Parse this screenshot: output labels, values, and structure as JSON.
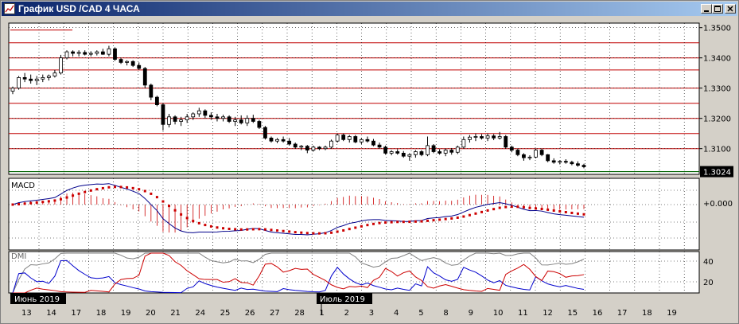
{
  "window": {
    "title": "График USD /CAD  4 ЧАСА",
    "buttons": [
      "minimize",
      "maximize",
      "close"
    ]
  },
  "colors": {
    "bg": "#d4d0c8",
    "plot_bg": "#ffffff",
    "level_line": "#c00000",
    "grid": "#000000",
    "macd_line": "#00008b",
    "signal_dots": "#cc0000",
    "dmi_plus": "#0000cc",
    "dmi_minus": "#cc0000",
    "adx": "#808080",
    "current_price_line": "#006400"
  },
  "main_panel": {
    "price_labels": [
      "1.3500",
      "1.3400",
      "1.3300",
      "1.3200",
      "1.3100"
    ],
    "current_price": "1.3024",
    "ylim": [
      1.3015,
      1.3515
    ]
  },
  "macd_panel": {
    "name": "MACD",
    "zero_label": "+0.000"
  },
  "dmi_panel": {
    "name": "DMI",
    "labels": [
      "40",
      "20"
    ]
  },
  "x_axis": {
    "month_labels": [
      "Июнь 2019",
      "Июль 2019"
    ],
    "day_labels": [
      "13",
      "14",
      "17",
      "18",
      "19",
      "20",
      "21",
      "24",
      "25",
      "26",
      "27",
      "28",
      "1",
      "2",
      "3",
      "4",
      "5",
      "8",
      "9",
      "10",
      "11",
      "12",
      "15",
      "16",
      "17",
      "18",
      "19"
    ]
  },
  "chart_data": {
    "type": "candlestick",
    "title": "График USD /CAD  4 ЧАСА",
    "series": [
      {
        "name": "USD/CAD",
        "values": [
          [
            1.329,
            1.3305,
            1.328,
            1.33
          ],
          [
            1.33,
            1.334,
            1.3295,
            1.3335
          ],
          [
            1.3335,
            1.335,
            1.332,
            1.333
          ],
          [
            1.333,
            1.3345,
            1.3315,
            1.3325
          ],
          [
            1.3325,
            1.334,
            1.331,
            1.333
          ],
          [
            1.333,
            1.3345,
            1.332,
            1.3335
          ],
          [
            1.3335,
            1.3345,
            1.3325,
            1.334
          ],
          [
            1.334,
            1.336,
            1.3335,
            1.335
          ],
          [
            1.335,
            1.341,
            1.3345,
            1.34
          ],
          [
            1.34,
            1.3425,
            1.3395,
            1.342
          ],
          [
            1.342,
            1.3425,
            1.3405,
            1.3415
          ],
          [
            1.3415,
            1.3425,
            1.3405,
            1.3418
          ],
          [
            1.3418,
            1.3425,
            1.3408,
            1.3412
          ],
          [
            1.3412,
            1.3422,
            1.3405,
            1.3415
          ],
          [
            1.3415,
            1.3425,
            1.3408,
            1.342
          ],
          [
            1.342,
            1.343,
            1.341,
            1.3412
          ],
          [
            1.3412,
            1.344,
            1.3405,
            1.343
          ],
          [
            1.343,
            1.3435,
            1.339,
            1.3395
          ],
          [
            1.3395,
            1.34,
            1.338,
            1.3385
          ],
          [
            1.3385,
            1.3392,
            1.3375,
            1.3388
          ],
          [
            1.3388,
            1.3392,
            1.337,
            1.3375
          ],
          [
            1.3375,
            1.3385,
            1.336,
            1.3365
          ],
          [
            1.3365,
            1.337,
            1.33,
            1.331
          ],
          [
            1.331,
            1.3315,
            1.326,
            1.327
          ],
          [
            1.327,
            1.3275,
            1.324,
            1.3245
          ],
          [
            1.3245,
            1.325,
            1.316,
            1.318
          ],
          [
            1.318,
            1.3215,
            1.317,
            1.3205
          ],
          [
            1.3205,
            1.321,
            1.318,
            1.319
          ],
          [
            1.319,
            1.3205,
            1.3175,
            1.3195
          ],
          [
            1.3195,
            1.3215,
            1.3185,
            1.3205
          ],
          [
            1.3205,
            1.322,
            1.3195,
            1.3215
          ],
          [
            1.3215,
            1.3235,
            1.3205,
            1.3225
          ],
          [
            1.3225,
            1.323,
            1.32,
            1.321
          ],
          [
            1.321,
            1.322,
            1.3195,
            1.3205
          ],
          [
            1.3205,
            1.3215,
            1.319,
            1.32
          ],
          [
            1.32,
            1.3212,
            1.319,
            1.3205
          ],
          [
            1.3205,
            1.321,
            1.3185,
            1.319
          ],
          [
            1.319,
            1.3205,
            1.3175,
            1.3195
          ],
          [
            1.3195,
            1.321,
            1.318,
            1.3185
          ],
          [
            1.3185,
            1.321,
            1.3175,
            1.32
          ],
          [
            1.32,
            1.3212,
            1.3185,
            1.319
          ],
          [
            1.319,
            1.3195,
            1.3165,
            1.317
          ],
          [
            1.317,
            1.3175,
            1.313,
            1.3135
          ],
          [
            1.3135,
            1.314,
            1.312,
            1.3125
          ],
          [
            1.3125,
            1.3135,
            1.3118,
            1.313
          ],
          [
            1.313,
            1.314,
            1.312,
            1.3125
          ],
          [
            1.3125,
            1.3135,
            1.311,
            1.3115
          ],
          [
            1.3115,
            1.312,
            1.31,
            1.3105
          ],
          [
            1.3105,
            1.3112,
            1.3095,
            1.3108
          ],
          [
            1.3108,
            1.3112,
            1.3085,
            1.3095
          ],
          [
            1.3095,
            1.311,
            1.309,
            1.3105
          ],
          [
            1.3105,
            1.3108,
            1.3095,
            1.31
          ],
          [
            1.31,
            1.311,
            1.3095,
            1.3105
          ],
          [
            1.3105,
            1.313,
            1.31,
            1.3125
          ],
          [
            1.3125,
            1.315,
            1.312,
            1.3145
          ],
          [
            1.3145,
            1.315,
            1.3125,
            1.313
          ],
          [
            1.313,
            1.3145,
            1.312,
            1.314
          ],
          [
            1.314,
            1.3145,
            1.3118,
            1.3122
          ],
          [
            1.3122,
            1.3135,
            1.3115,
            1.313
          ],
          [
            1.313,
            1.314,
            1.312,
            1.3125
          ],
          [
            1.3125,
            1.3132,
            1.3108,
            1.3112
          ],
          [
            1.3112,
            1.312,
            1.31,
            1.3105
          ],
          [
            1.3105,
            1.311,
            1.308,
            1.3085
          ],
          [
            1.3085,
            1.3095,
            1.3078,
            1.309
          ],
          [
            1.309,
            1.3098,
            1.308,
            1.3085
          ],
          [
            1.3085,
            1.3092,
            1.307,
            1.3075
          ],
          [
            1.3075,
            1.3085,
            1.306,
            1.308
          ],
          [
            1.308,
            1.3095,
            1.307,
            1.309
          ],
          [
            1.309,
            1.3095,
            1.3075,
            1.308
          ],
          [
            1.308,
            1.314,
            1.3075,
            1.311
          ],
          [
            1.311,
            1.3115,
            1.3085,
            1.309
          ],
          [
            1.309,
            1.3098,
            1.308,
            1.3085
          ],
          [
            1.3085,
            1.31,
            1.3075,
            1.3095
          ],
          [
            1.3095,
            1.3102,
            1.308,
            1.3088
          ],
          [
            1.3088,
            1.311,
            1.3082,
            1.3105
          ],
          [
            1.3105,
            1.314,
            1.31,
            1.313
          ],
          [
            1.313,
            1.3145,
            1.312,
            1.3138
          ],
          [
            1.3138,
            1.315,
            1.3125,
            1.314
          ],
          [
            1.314,
            1.3148,
            1.313,
            1.3135
          ],
          [
            1.3135,
            1.315,
            1.3125,
            1.3142
          ],
          [
            1.3142,
            1.3148,
            1.3128,
            1.3135
          ],
          [
            1.3135,
            1.3155,
            1.313,
            1.314
          ],
          [
            1.314,
            1.3145,
            1.31,
            1.3105
          ],
          [
            1.3105,
            1.311,
            1.3088,
            1.3095
          ],
          [
            1.3095,
            1.31,
            1.3075,
            1.308
          ],
          [
            1.308,
            1.3085,
            1.306,
            1.307
          ],
          [
            1.307,
            1.3078,
            1.3062,
            1.3072
          ],
          [
            1.3072,
            1.31,
            1.3068,
            1.3095
          ],
          [
            1.3095,
            1.31,
            1.3075,
            1.308
          ],
          [
            1.308,
            1.3082,
            1.3055,
            1.306
          ],
          [
            1.306,
            1.3068,
            1.305,
            1.3055
          ],
          [
            1.3055,
            1.3062,
            1.3048,
            1.3058
          ],
          [
            1.3058,
            1.3065,
            1.305,
            1.3055
          ],
          [
            1.3055,
            1.306,
            1.3045,
            1.305
          ],
          [
            1.305,
            1.3058,
            1.304,
            1.3045
          ],
          [
            1.3045,
            1.305,
            1.3035,
            1.304
          ]
        ]
      }
    ]
  }
}
